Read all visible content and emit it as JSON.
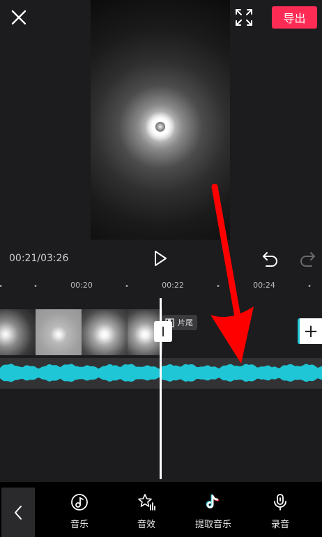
{
  "header": {
    "export_label": "导出",
    "close_icon": "close-icon",
    "fullscreen_icon": "fullscreen-icon"
  },
  "player": {
    "timecode": "00:21/03:26",
    "play_icon": "play-icon",
    "undo_icon": "undo-icon",
    "redo_icon": "redo-icon"
  },
  "timeline": {
    "ruler_labels": [
      "00:20",
      "00:22",
      "00:24"
    ],
    "ending_label": "片尾",
    "add_clip_label": "+"
  },
  "toolbar": {
    "items": [
      {
        "label": "音乐",
        "icon": "music-note-icon"
      },
      {
        "label": "音效",
        "icon": "sound-effect-icon"
      },
      {
        "label": "提取音乐",
        "icon": "tiktok-icon"
      },
      {
        "label": "录音",
        "icon": "microphone-icon"
      }
    ],
    "back_icon": "chevron-left-icon"
  },
  "colors": {
    "accent": "#fe2c55",
    "waveform": "#1ec6d6",
    "annotation": "#ff0000",
    "background": "#1c1c1e"
  }
}
